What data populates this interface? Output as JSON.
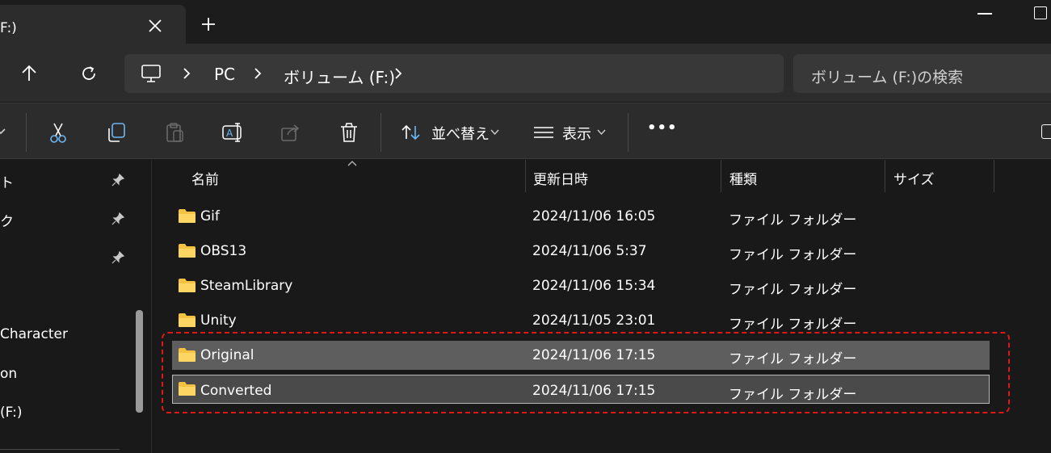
{
  "window": {
    "tab_title": "F:)",
    "new_tab_label": "+"
  },
  "address_bar": {
    "crumbs": [
      "PC",
      "ボリューム (F:)"
    ],
    "search_placeholder": "ボリューム (F:)の検索"
  },
  "command_bar": {
    "sort_label": "並べ替え",
    "view_label": "表示",
    "more_label": "•••"
  },
  "sidebar": {
    "items": [
      {
        "label": "ト",
        "pinned": true
      },
      {
        "label": "ク",
        "pinned": true
      },
      {
        "label": "",
        "pinned": true
      },
      {
        "label": "Character",
        "pinned": false
      },
      {
        "label": "on",
        "pinned": false
      },
      {
        "label": " (F:)",
        "pinned": false
      }
    ]
  },
  "file_list": {
    "columns": [
      "名前",
      "更新日時",
      "種類",
      "サイズ"
    ],
    "rows": [
      {
        "name": "Gif",
        "modified": "2024/11/06 16:05",
        "type": "ファイル フォルダー",
        "size": "",
        "selected": false
      },
      {
        "name": "OBS13",
        "modified": "2024/11/06 5:37",
        "type": "ファイル フォルダー",
        "size": "",
        "selected": false
      },
      {
        "name": "SteamLibrary",
        "modified": "2024/11/06 15:34",
        "type": "ファイル フォルダー",
        "size": "",
        "selected": false
      },
      {
        "name": "Unity",
        "modified": "2024/11/05 23:01",
        "type": "ファイル フォルダー",
        "size": "",
        "selected": false
      },
      {
        "name": "Original",
        "modified": "2024/11/06 17:15",
        "type": "ファイル フォルダー",
        "size": "",
        "selected": true
      },
      {
        "name": "Converted",
        "modified": "2024/11/06 17:15",
        "type": "ファイル フォルダー",
        "size": "",
        "selected": true
      }
    ]
  },
  "colors": {
    "folder": "#f5c242",
    "accent_icon": "#6cb8f5",
    "highlight_dash": "#e01818"
  }
}
